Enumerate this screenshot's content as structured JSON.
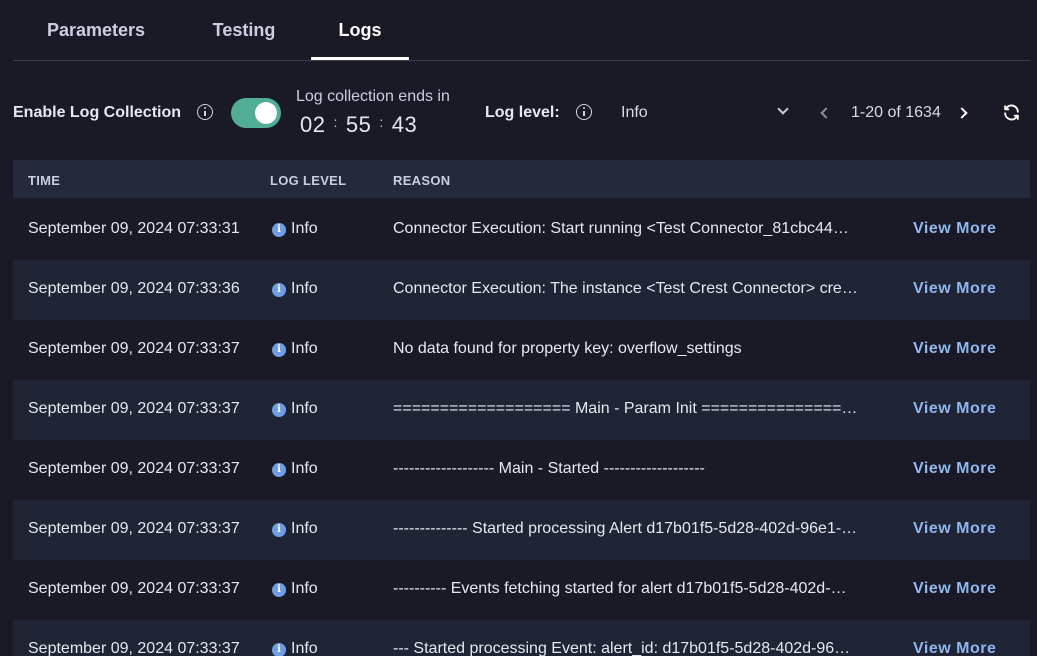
{
  "tabs": [
    {
      "label": "Parameters",
      "active": false
    },
    {
      "label": "Testing",
      "active": false
    },
    {
      "label": "Logs",
      "active": true
    }
  ],
  "controls": {
    "enable_label": "Enable Log Collection",
    "toggle_on": true,
    "ends_label": "Log collection ends in",
    "timer": {
      "hours": "02",
      "minutes": "55",
      "seconds": "43"
    },
    "log_level_label": "Log level:",
    "log_level_value": "Info",
    "pagination": "1-20 of 1634"
  },
  "table": {
    "headers": {
      "time": "TIME",
      "level": "LOG LEVEL",
      "reason": "REASON"
    },
    "rows": [
      {
        "time": "September 09, 2024 07:33:31",
        "level": "Info",
        "reason": "Connector Execution: Start running <Test Connector_81cbc44…",
        "action": "View More"
      },
      {
        "time": "September 09, 2024 07:33:36",
        "level": "Info",
        "reason": "Connector Execution: The instance <Test Crest Connector> cre…",
        "action": "View More"
      },
      {
        "time": "September 09, 2024 07:33:37",
        "level": "Info",
        "reason": "No data found for property key: overflow_settings",
        "action": "View More"
      },
      {
        "time": "September 09, 2024 07:33:37",
        "level": "Info",
        "reason": "=================== Main - Param Init ================…",
        "action": "View More"
      },
      {
        "time": "September 09, 2024 07:33:37",
        "level": "Info",
        "reason": "------------------- Main - Started -------------------",
        "action": "View More"
      },
      {
        "time": "September 09, 2024 07:33:37",
        "level": "Info",
        "reason": "-------------- Started processing Alert d17b01f5-5d28-402d-96e1-…",
        "action": "View More"
      },
      {
        "time": "September 09, 2024 07:33:37",
        "level": "Info",
        "reason": "---------- Events fetching started for alert d17b01f5-5d28-402d-…",
        "action": "View More"
      },
      {
        "time": "September 09, 2024 07:33:37",
        "level": "Info",
        "reason": "--- Started processing Event: alert_id: d17b01f5-5d28-402d-96…",
        "action": "View More"
      }
    ]
  },
  "colors": {
    "background": "#1a1a26",
    "toggle": "#4fae93",
    "link": "#8fb6ee",
    "info_badge": "#6f9de6",
    "header": "#242a3b",
    "row_alt": "#1f2535"
  }
}
